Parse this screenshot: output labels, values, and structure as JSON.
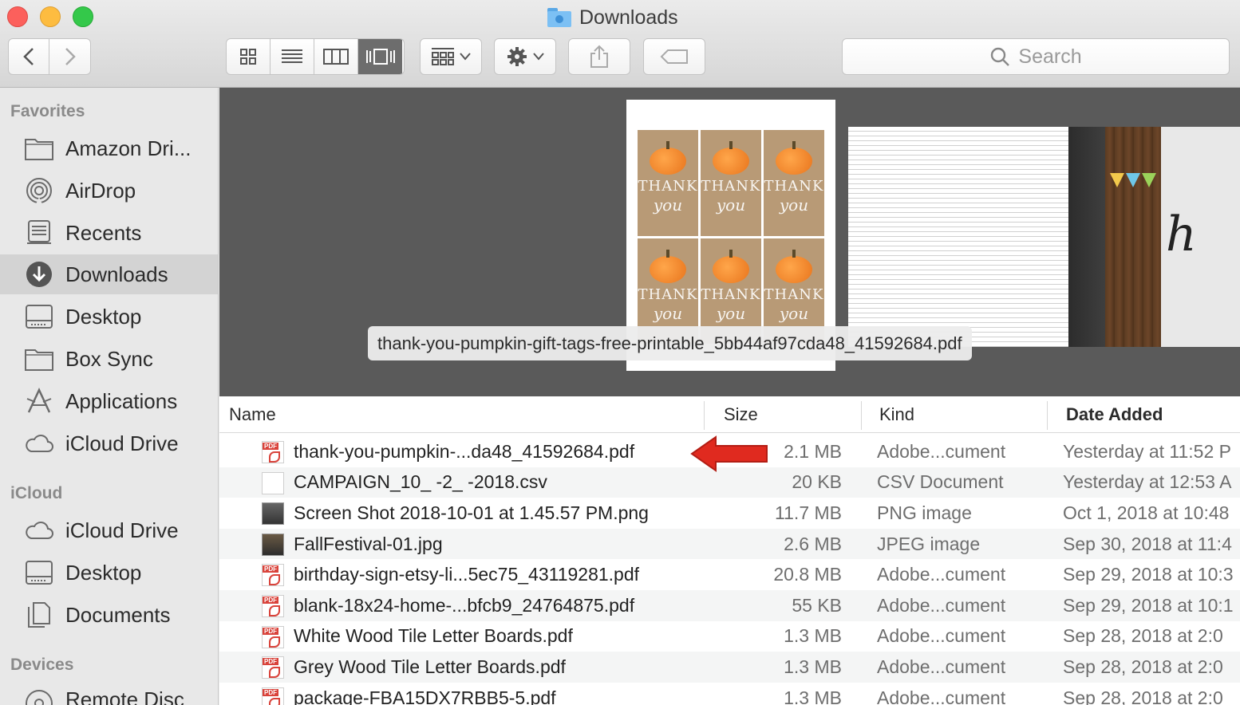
{
  "window": {
    "title": "Downloads"
  },
  "toolbar": {
    "search_placeholder": "Search"
  },
  "sidebar": {
    "favorites_heading": "Favorites",
    "favorites": [
      {
        "label": "Amazon Dri...",
        "icon": "folder-icon"
      },
      {
        "label": "AirDrop",
        "icon": "airdrop-icon"
      },
      {
        "label": "Recents",
        "icon": "recents-icon"
      },
      {
        "label": "Downloads",
        "icon": "downloads-icon",
        "selected": true
      },
      {
        "label": "Desktop",
        "icon": "desktop-icon"
      },
      {
        "label": "Box Sync",
        "icon": "folder-icon"
      },
      {
        "label": "Applications",
        "icon": "applications-icon"
      },
      {
        "label": "iCloud Drive",
        "icon": "cloud-icon"
      }
    ],
    "icloud_heading": "iCloud",
    "icloud": [
      {
        "label": "iCloud Drive",
        "icon": "cloud-icon"
      },
      {
        "label": "Desktop",
        "icon": "desktop-icon"
      },
      {
        "label": "Documents",
        "icon": "documents-icon"
      }
    ],
    "devices_heading": "Devices",
    "devices": [
      {
        "label": "Remote Disc",
        "icon": "disc-icon"
      }
    ]
  },
  "coverflow": {
    "selected_filename": "thank-you-pumpkin-gift-tags-free-printable_5bb44af97cda48_41592684.pdf",
    "tag_text_1": "THANK",
    "tag_text_2": "you"
  },
  "columns": {
    "name": "Name",
    "size": "Size",
    "kind": "Kind",
    "date": "Date Added"
  },
  "files": [
    {
      "name": "thank-you-pumpkin-...da48_41592684.pdf",
      "size": "2.1 MB",
      "kind": "Adobe...cument",
      "date": "Yesterday at 11:52 P",
      "type": "pdf"
    },
    {
      "name": "CAMPAIGN_10_  -2_  -2018.csv",
      "size": "20 KB",
      "kind": "CSV Document",
      "date": "Yesterday at 12:53 A",
      "type": "csv"
    },
    {
      "name": "Screen Shot 2018-10-01 at 1.45.57 PM.png",
      "size": "11.7 MB",
      "kind": "PNG image",
      "date": "Oct 1, 2018 at 10:48",
      "type": "img"
    },
    {
      "name": "FallFestival-01.jpg",
      "size": "2.6 MB",
      "kind": "JPEG image",
      "date": "Sep 30, 2018 at 11:4",
      "type": "jpg"
    },
    {
      "name": "birthday-sign-etsy-li...5ec75_43119281.pdf",
      "size": "20.8 MB",
      "kind": "Adobe...cument",
      "date": "Sep 29, 2018 at 10:3",
      "type": "pdf"
    },
    {
      "name": "blank-18x24-home-...bfcb9_24764875.pdf",
      "size": "55 KB",
      "kind": "Adobe...cument",
      "date": "Sep 29, 2018 at 10:1",
      "type": "pdf"
    },
    {
      "name": "White Wood Tile Letter Boards.pdf",
      "size": "1.3 MB",
      "kind": "Adobe...cument",
      "date": "Sep 28, 2018 at 2:0",
      "type": "pdf"
    },
    {
      "name": "Grey Wood Tile Letter Boards.pdf",
      "size": "1.3 MB",
      "kind": "Adobe...cument",
      "date": "Sep 28, 2018 at 2:0",
      "type": "pdf"
    },
    {
      "name": "package-FBA15DX7RBB5-5.pdf",
      "size": "1.3 MB",
      "kind": "Adobe...cument",
      "date": "Sep 28, 2018 at 2:0",
      "type": "pdf"
    }
  ],
  "colors": {
    "arrow": "#e02a1f",
    "selected_sidebar": "#d3d3d3",
    "coverflow_bg": "#5a5a5a"
  }
}
